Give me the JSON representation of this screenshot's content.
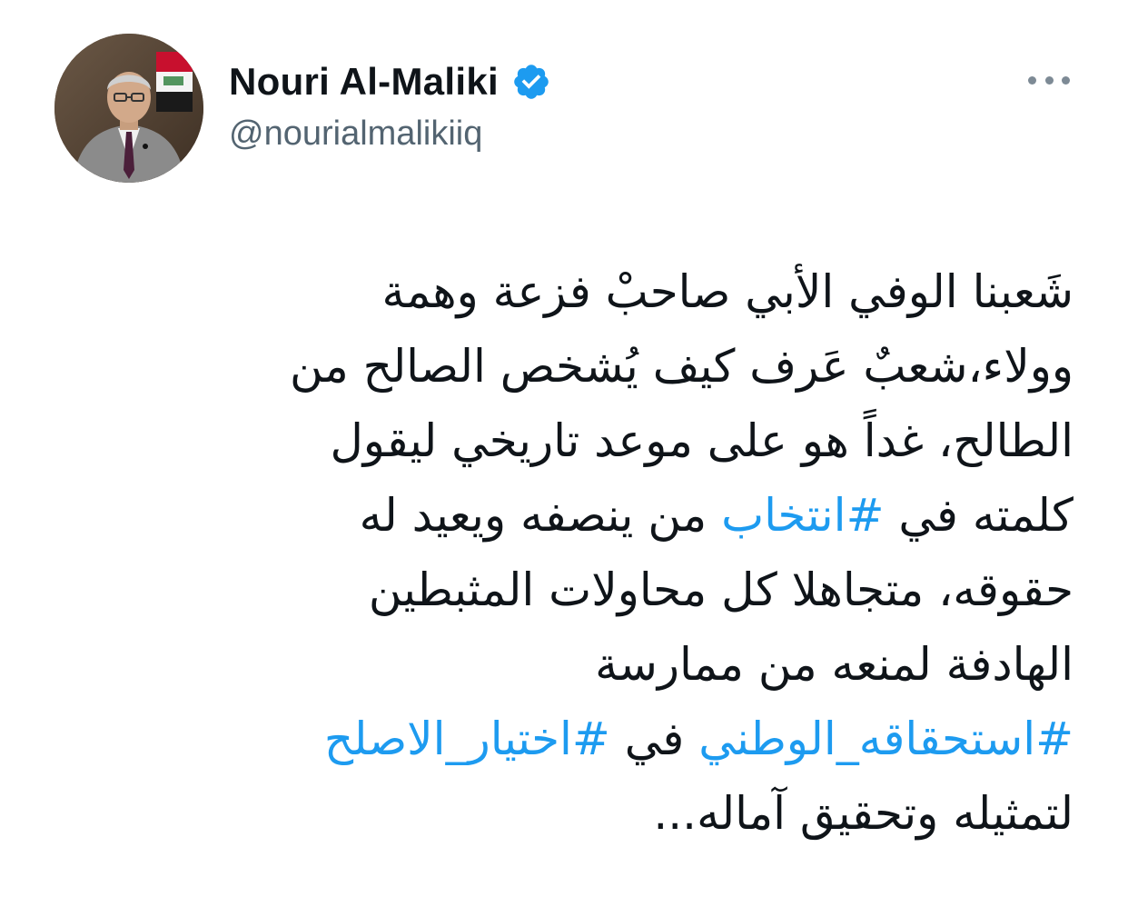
{
  "author": {
    "display_name": "Nouri Al-Maliki",
    "handle": "@nourialmalikiiq",
    "verified": true,
    "verified_icon": "verified-badge-icon",
    "avatar_icon": "profile-photo"
  },
  "more_icon": "more-options-icon",
  "colors": {
    "text": "#0f1419",
    "secondary": "#536471",
    "hashtag": "#1d9bf0",
    "verified": "#1d9bf0"
  },
  "tweet": {
    "line1": "شَعبنا الوفي الأبي صاحبْ فزعة وهمة",
    "line2": "وولاء،شعبٌ عَرف كيف يُشخص الصالح من",
    "line3": "الطالح، غداً هو على موعد تاريخي ليقول",
    "line4_before": "كلمته في ",
    "line4_hashtag": "#انتخاب",
    "line4_after": " من ينصفه ويعيد له",
    "line5": "حقوقه، متجاهلا كل محاولات المثبطين",
    "line6": "الهادفة لمنعه من ممارسة",
    "line7_hashtag1": "#استحقاقه_الوطني",
    "line7_middle": " في ",
    "line7_hashtag2": "#اختيار_الاصلح",
    "line8": "لتمثيله وتحقيق آماله..."
  }
}
